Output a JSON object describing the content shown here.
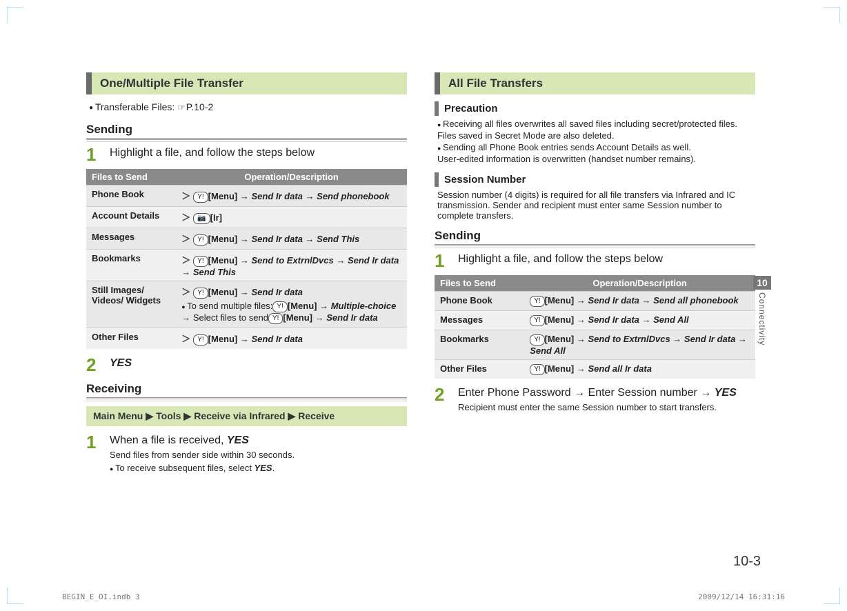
{
  "left": {
    "section_title": "One/Multiple File Transfer",
    "transferable_files": "Transferable Files:",
    "transferable_ref": "P.10-2",
    "sending_head": "Sending",
    "step1_text": "Highlight a file, and follow the steps below",
    "table": {
      "col1": "Files to Send",
      "col2": "Operation/Description",
      "rows": [
        {
          "label": "Phone Book",
          "op": "[Menu] → Send Ir data → Send phonebook",
          "chev": true,
          "key": "Y!"
        },
        {
          "label": "Account Details",
          "op": "[Ir]",
          "chev": true,
          "key": "📷"
        },
        {
          "label": "Messages",
          "op": "[Menu] → Send Ir data → Send This",
          "chev": true,
          "key": "Y!"
        },
        {
          "label": "Bookmarks",
          "op": "[Menu] → Send to ExtrnlDvcs → Send Ir data → Send This",
          "chev": true,
          "key": "Y!"
        },
        {
          "label": "Still Images/ Videos/ Widgets",
          "op": "[Menu] → Send Ir data",
          "chev": true,
          "key": "Y!",
          "extra": "To send multiple files: [Menu] → Multiple-choice → Select files to send → [Menu] → Send Ir data"
        },
        {
          "label": "Other Files",
          "op": "[Menu] → Send Ir data",
          "chev": true,
          "key": "Y!"
        }
      ]
    },
    "step2_text": "YES",
    "receiving_head": "Receiving",
    "menu_path": [
      "Main Menu",
      "Tools",
      "Receive via Infrared",
      "Receive"
    ],
    "recv_step1": "When a file is received, ",
    "recv_step1_yes": "YES",
    "recv_sub1": "Send files from sender side within 30 seconds.",
    "recv_sub2": "To receive subsequent files, select ",
    "recv_sub2_yes": "YES",
    "recv_sub2_end": "."
  },
  "right": {
    "section_title": "All File Transfers",
    "precaution_title": "Precaution",
    "precaution_lines": [
      "Receiving all files overwrites all saved files including secret/protected files.",
      "Files saved in Secret Mode are also deleted.",
      "Sending all Phone Book entries sends Account Details as well.",
      "User-edited information is overwritten (handset number remains)."
    ],
    "session_title": "Session Number",
    "session_body": "Session number (4 digits) is required for all file transfers via Infrared and IC transmission. Sender and recipient must enter same Session number to complete transfers.",
    "sending_head": "Sending",
    "step1_text": "Highlight a file, and follow the steps below",
    "table": {
      "col1": "Files to Send",
      "col2": "Operation/Description",
      "rows": [
        {
          "label": "Phone Book",
          "op": "[Menu] → Send Ir data → Send all phonebook",
          "key": "Y!"
        },
        {
          "label": "Messages",
          "op": "[Menu] → Send Ir data → Send All",
          "key": "Y!"
        },
        {
          "label": "Bookmarks",
          "op": "[Menu] → Send to ExtrnlDvcs → Send Ir data → Send All",
          "key": "Y!"
        },
        {
          "label": "Other Files",
          "op": "[Menu] → Send all Ir data",
          "key": "Y!"
        }
      ]
    },
    "step2_text": "Enter Phone Password → Enter Session number → ",
    "step2_yes": "YES",
    "step2_sub": "Recipient must enter the same Session number to start transfers."
  },
  "side": {
    "chapter": "10",
    "label": "Connectivity"
  },
  "page_number": "10-3",
  "footer_left": "BEGIN_E_OI.indb   3",
  "footer_right": "2009/12/14   16:31:16"
}
